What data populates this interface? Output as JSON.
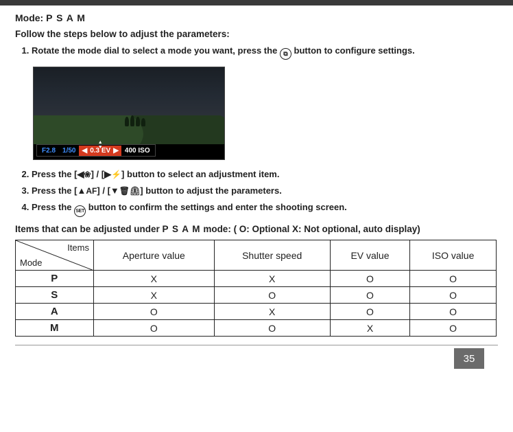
{
  "header": {
    "mode_label": "Mode:",
    "mode_value": "P S A M",
    "intro": "Follow the steps below to adjust the parameters:"
  },
  "steps": {
    "s1a": "Rotate the mode dial to select a mode you want, press the ",
    "s1b": " button to configure settings.",
    "s2a": "Press the ",
    "s2b": " button to select an adjustment item.",
    "s3a": "Press the ",
    "s3b": " button to adjust the parameters.",
    "s4a": "Press the ",
    "s4b": " button to confirm the settings and enter the shooting screen."
  },
  "button_glyphs": {
    "left": "◀",
    "right": "▶",
    "up": "▲",
    "down": "▼",
    "macro": "❀",
    "flash": "⚡",
    "af": "AF",
    "trash": "🗑",
    "timer": "⏲",
    "ev_symbol": "⧉",
    "set": "SET",
    "slash": " / "
  },
  "screenshot": {
    "aperture": "F2.8",
    "shutter": "1/50",
    "left_arrow": "◀",
    "ev": "0.3 EV",
    "right_arrow": "▶",
    "iso": "400 ISO"
  },
  "table": {
    "intro_a": "Items that can be adjusted under ",
    "intro_mode": "P S A M",
    "intro_b": " mode: ( O: Optional X: Not optional, auto display)",
    "diag_top": "Items",
    "diag_bottom": "Mode",
    "headers": [
      "Aperture value",
      "Shutter speed",
      "EV value",
      "ISO value"
    ],
    "rows": [
      {
        "mode": "P",
        "v": [
          "X",
          "X",
          "O",
          "O"
        ]
      },
      {
        "mode": "S",
        "v": [
          "X",
          "O",
          "O",
          "O"
        ]
      },
      {
        "mode": "A",
        "v": [
          "O",
          "X",
          "O",
          "O"
        ]
      },
      {
        "mode": "M",
        "v": [
          "O",
          "O",
          "X",
          "O"
        ]
      }
    ]
  },
  "page_number": "35"
}
